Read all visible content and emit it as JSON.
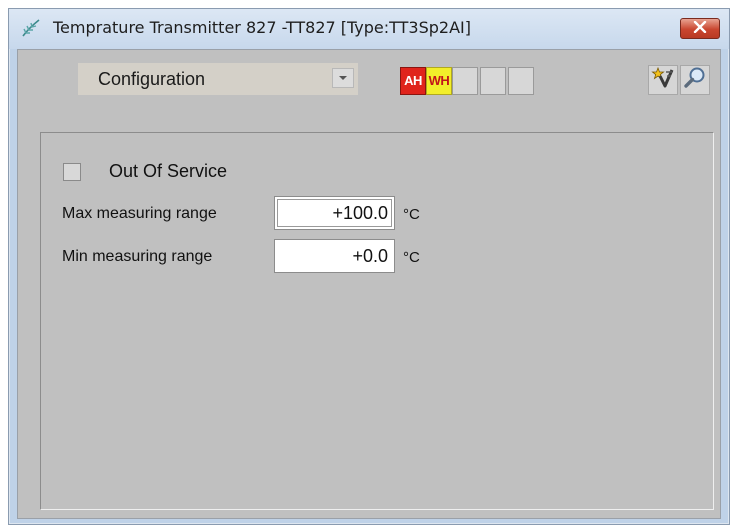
{
  "window": {
    "title": "Temprature Transmitter 827 -TT827  [Type:TT3Sp2AI]",
    "icon": "fern-app-icon",
    "close_icon": "close-x-icon"
  },
  "toolbar": {
    "view_select": "Configuration",
    "alarm_indicators": [
      {
        "label": "AH",
        "color": "#e0241c",
        "text_color": "#ffffff",
        "active": true
      },
      {
        "label": "WH",
        "color": "#f2ee2a",
        "text_color": "#c2141a",
        "active": true
      },
      {
        "label": "",
        "active": false
      },
      {
        "label": "",
        "active": false
      },
      {
        "label": "",
        "active": false
      }
    ],
    "buttons": [
      {
        "icon": "star-check-icon"
      },
      {
        "icon": "magnifier-icon"
      }
    ]
  },
  "config": {
    "out_of_service": {
      "label": "Out Of Service",
      "checked": false
    },
    "fields": [
      {
        "label": "Max measuring range",
        "value": "+100.0",
        "unit": "°C"
      },
      {
        "label": "Min measuring range",
        "value": "+0.0",
        "unit": "°C"
      }
    ]
  }
}
